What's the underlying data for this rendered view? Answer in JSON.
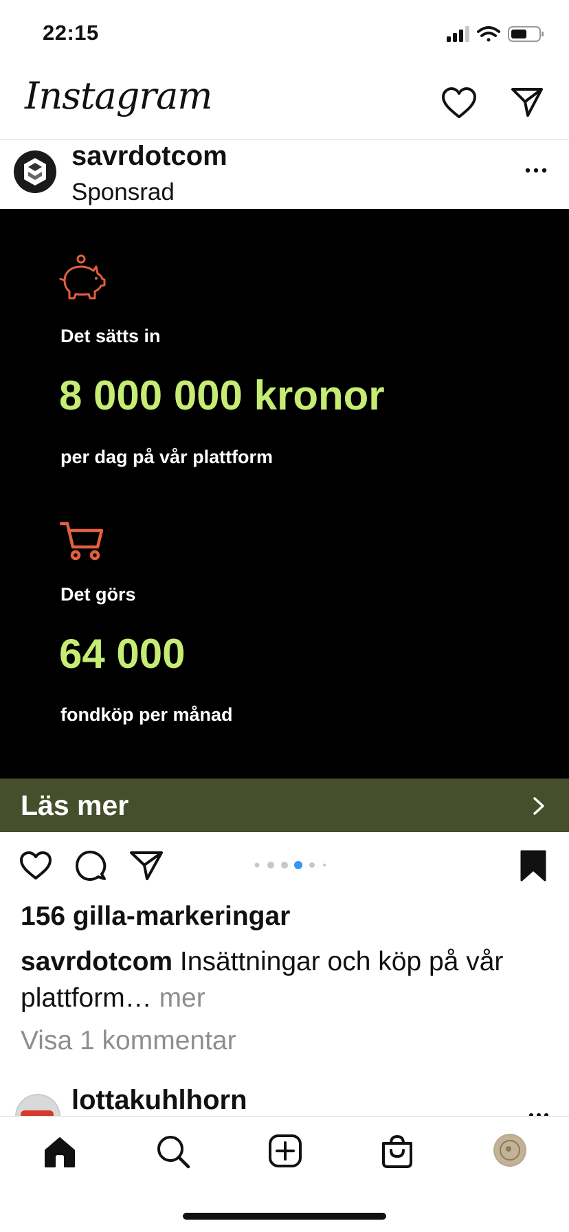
{
  "status_bar": {
    "time": "22:15"
  },
  "header": {
    "logo": "Instagram",
    "icons": [
      "heart-icon",
      "send-icon"
    ]
  },
  "post": {
    "username": "savrdotcom",
    "sponsored_label": "Sponsrad",
    "ad": {
      "label_1": "Det sätts in",
      "big_1": "8 000 000 kronor",
      "sub_1": "per dag på vår plattform",
      "label_2": "Det görs",
      "big_2": "64 000",
      "sub_2": "fondköp per månad",
      "accent_color": "#c6ec74",
      "icon_color": "#e2603f"
    },
    "cta": {
      "label": "Läs mer",
      "color": "#464f2b"
    },
    "carousel": {
      "total": 6,
      "active_index": 3
    },
    "likes": "156 gilla-markeringar",
    "caption": {
      "user": "savrdotcom",
      "text": "Insättningar och köp på vår plattform…",
      "more": "mer"
    },
    "view_comments": "Visa 1 kommentar"
  },
  "next_post": {
    "username": "lottakuhlhorn"
  },
  "tab_bar": {
    "items": [
      "home-icon",
      "search-icon",
      "new-post-icon",
      "shop-icon",
      "profile-avatar"
    ]
  }
}
